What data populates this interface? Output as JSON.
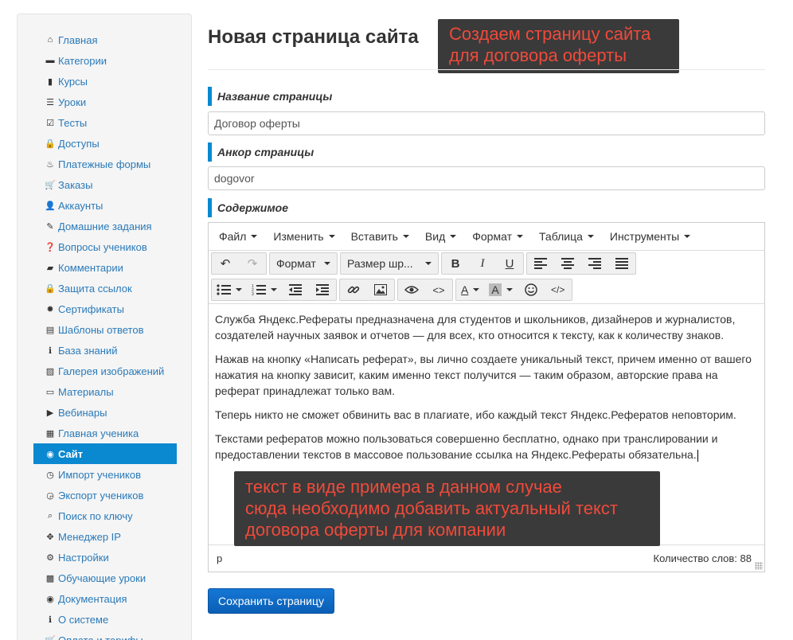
{
  "sidebar": {
    "items": [
      {
        "label": "Главная",
        "icon": "⌂"
      },
      {
        "label": "Категории",
        "icon": "▬"
      },
      {
        "label": "Курсы",
        "icon": "▮"
      },
      {
        "label": "Уроки",
        "icon": "☰"
      },
      {
        "label": "Тесты",
        "icon": "☑"
      },
      {
        "label": "Доступы",
        "icon": "🔒"
      },
      {
        "label": "Платежные формы",
        "icon": "♨"
      },
      {
        "label": "Заказы",
        "icon": "🛒"
      },
      {
        "label": "Аккаунты",
        "icon": "👤"
      },
      {
        "label": "Домашние задания",
        "icon": "✎"
      },
      {
        "label": "Вопросы учеников",
        "icon": "❓"
      },
      {
        "label": "Комментарии",
        "icon": "▰"
      },
      {
        "label": "Защита ссылок",
        "icon": "🔒"
      },
      {
        "label": "Сертификаты",
        "icon": "✹"
      },
      {
        "label": "Шаблоны ответов",
        "icon": "▤"
      },
      {
        "label": "База знаний",
        "icon": "ℹ"
      },
      {
        "label": "Галерея изображений",
        "icon": "▨"
      },
      {
        "label": "Материалы",
        "icon": "▭"
      },
      {
        "label": "Вебинары",
        "icon": "▶"
      },
      {
        "label": "Главная ученика",
        "icon": "▦"
      },
      {
        "label": "Сайт",
        "icon": "◉"
      },
      {
        "label": "Импорт учеников",
        "icon": "◷"
      },
      {
        "label": "Экспорт учеников",
        "icon": "◶"
      },
      {
        "label": "Поиск по ключу",
        "icon": "⌕"
      },
      {
        "label": "Менеджер IP",
        "icon": "✥"
      },
      {
        "label": "Настройки",
        "icon": "⚙"
      },
      {
        "label": "Обучающие уроки",
        "icon": "▩"
      },
      {
        "label": "Документация",
        "icon": "◉"
      },
      {
        "label": "О системе",
        "icon": "ℹ"
      },
      {
        "label": "Оплата и тарифы",
        "icon": "🛒"
      }
    ],
    "active_index": 20
  },
  "page": {
    "title": "Новая страница сайта",
    "callout_top": [
      "Создаем страницу сайта",
      "для договора оферты"
    ],
    "callout_bottom": [
      "текст в виде примера в данном случае",
      "сюда необходимо добавить актуальный текст",
      "договора оферты для компании"
    ]
  },
  "form": {
    "name_label": "Название страницы",
    "name_value": "Договор оферты",
    "anchor_label": "Анкор страницы",
    "anchor_value": "dogovor",
    "content_label": "Содержимое"
  },
  "editor": {
    "menu": [
      "Файл",
      "Изменить",
      "Вставить",
      "Вид",
      "Формат",
      "Таблица",
      "Инструменты"
    ],
    "format_select": "Формат",
    "font_size_select": "Размер шр...",
    "paragraphs": [
      "Служба Яндекс.Рефераты предназначена для студентов и школьников, дизайнеров и журналистов, создателей научных заявок и отчетов — для всех, кто относится к тексту, как к количеству знаков.",
      "Нажав на кнопку «Написать реферат», вы лично создаете уникальный текст, причем именно от вашего нажатия на кнопку зависит, каким именно текст получится — таким образом, авторские права на реферат принадлежат только вам.",
      "Теперь никто не сможет обвинить вас в плагиате, ибо каждый текст Яндекс.Рефератов неповторим.",
      "Текстами рефератов можно пользоваться совершенно бесплатно, однако при транслировании и предоставлении текстов в массовое пользование ссылка на Яндекс.Рефераты обязательна."
    ],
    "status_path": "p",
    "word_count": "Количество слов: 88"
  },
  "actions": {
    "save_label": "Сохранить страницу"
  }
}
